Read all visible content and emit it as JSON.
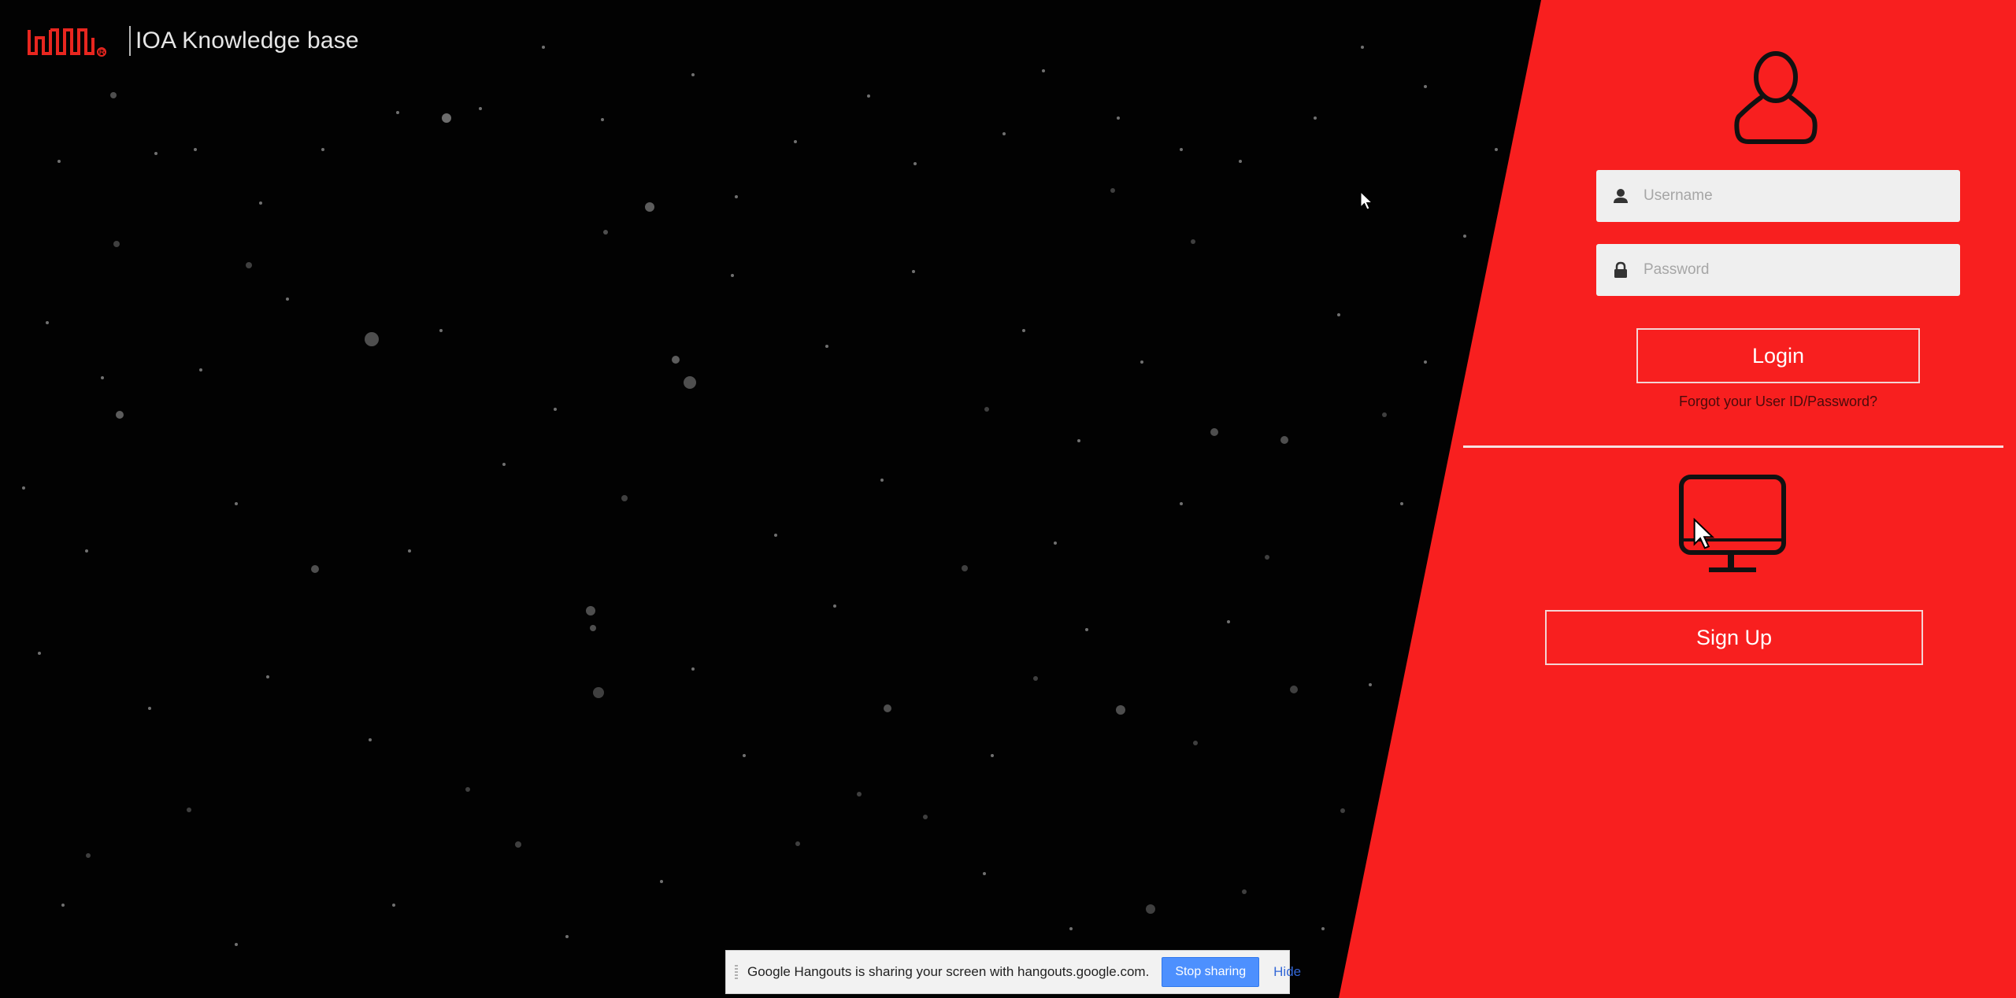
{
  "header": {
    "logo_icon": "equinix-logo-icon",
    "title": "IOA Knowledge base"
  },
  "login": {
    "user_icon": "user-silhouette-icon",
    "username_placeholder": "Username",
    "password_placeholder": "Password",
    "login_label": "Login",
    "forgot_label": "Forgot your User ID/Password?"
  },
  "signup": {
    "monitor_icon": "monitor-icon",
    "signup_label": "Sign Up"
  },
  "share_bar": {
    "message": "Google Hangouts is sharing your screen with hangouts.google.com.",
    "stop_label": "Stop sharing",
    "hide_label": "Hide"
  },
  "colors": {
    "panel_red": "#f81f1f",
    "background": "#020202",
    "button_blue": "#4d90fe"
  }
}
